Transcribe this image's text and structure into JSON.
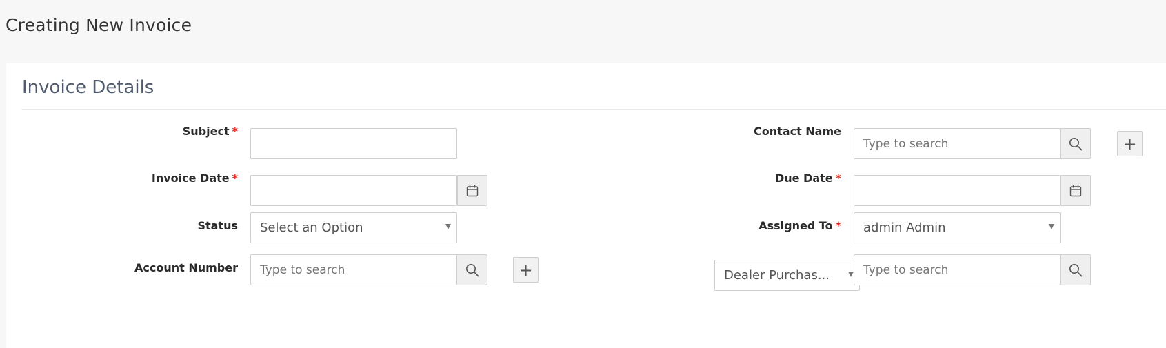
{
  "page": {
    "title": "Creating New Invoice"
  },
  "section": {
    "title": "Invoice Details"
  },
  "fields": {
    "subject": {
      "label": "Subject",
      "required": "*",
      "value": ""
    },
    "invoice_date": {
      "label": "Invoice Date",
      "required": "*",
      "value": ""
    },
    "status": {
      "label": "Status",
      "selected": "Select an Option"
    },
    "account_number": {
      "label": "Account Number",
      "placeholder": "Type to search"
    },
    "contact_name": {
      "label": "Contact Name",
      "placeholder": "Type to search"
    },
    "due_date": {
      "label": "Due Date",
      "required": "*",
      "value": ""
    },
    "assigned_to": {
      "label": "Assigned To",
      "required": "*",
      "selected": "admin Admin"
    },
    "related_type": {
      "selected": "Dealer Purchas..."
    },
    "related_record": {
      "placeholder": "Type to search"
    }
  },
  "buttons": {
    "plus_glyph": "+"
  },
  "icons": {
    "search": "search-icon",
    "calendar": "calendar-icon",
    "plus": "plus-icon",
    "dropdown": "chevron-down-icon"
  },
  "colors": {
    "required": "#e1251b",
    "section_title": "#505c6e",
    "border": "#cfcfcf",
    "addon_bg": "#efefef"
  }
}
